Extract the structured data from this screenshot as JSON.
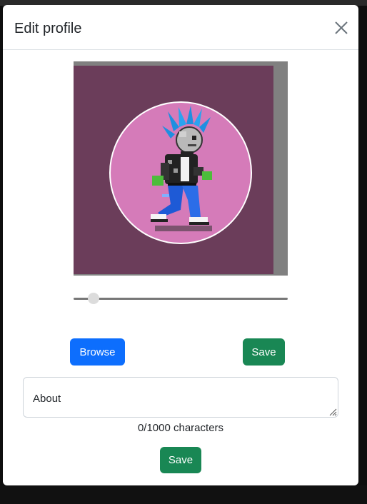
{
  "modal": {
    "title": "Edit profile",
    "close_icon": "close-icon"
  },
  "image_editor": {
    "background_color": "#6b3d5a",
    "avatar_bg_color": "#d57bb9",
    "zoom_level": 0.07
  },
  "buttons": {
    "browse_label": "Browse",
    "save_image_label": "Save",
    "save_about_label": "Save"
  },
  "about": {
    "placeholder": "About",
    "value": ""
  },
  "char_counter": "0/1000 characters",
  "colors": {
    "primary": "#0d6efd",
    "success": "#198754"
  }
}
